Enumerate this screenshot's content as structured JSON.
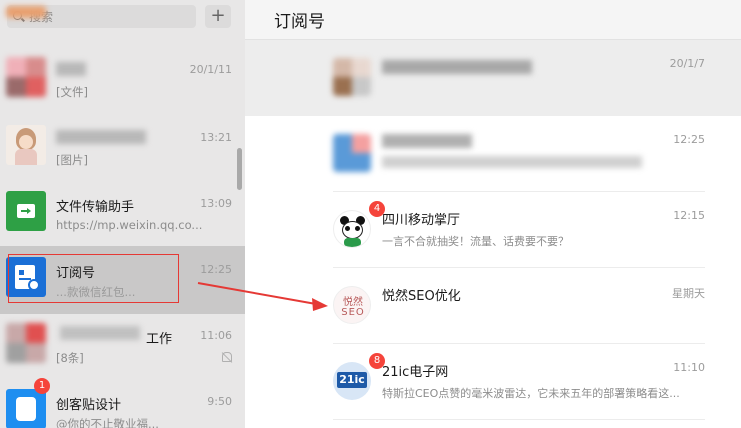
{
  "search": {
    "placeholder": "搜索",
    "add_label": "+"
  },
  "chats": [
    {
      "name": "",
      "time": "20/1/11",
      "preview": "[文件]"
    },
    {
      "name": "",
      "time": "13:21",
      "preview": "[图片]"
    },
    {
      "name": "文件传输助手",
      "time": "13:09",
      "preview": "https://mp.weixin.qq.co..."
    },
    {
      "name": "订阅号",
      "time": "12:25",
      "preview": "...款微信红包..."
    },
    {
      "name": "工作",
      "time": "11:06",
      "preview": "[8条]"
    },
    {
      "name": "创客贴设计",
      "time": "9:50",
      "preview": "@你的不止敬业福...",
      "badge": "1"
    }
  ],
  "page": {
    "title": "订阅号"
  },
  "subscriptions": [
    {
      "name": "",
      "time": "20/1/7",
      "preview": ""
    },
    {
      "name": "",
      "time": "12:25",
      "preview": ""
    },
    {
      "name": "四川移动掌厅",
      "time": "12:15",
      "preview": "一言不合就抽奖！流量、话费要不要？",
      "badge": "4"
    },
    {
      "name": "悦然SEO优化",
      "time": "星期天",
      "preview": "",
      "avatar_text_top": "悦然",
      "avatar_text_bottom": "SEO"
    },
    {
      "name": "21ic电子网",
      "time": "11:10",
      "preview": "特斯拉CEO点赞的毫米波雷达，它未来五年的部署策略看这...",
      "badge": "8",
      "avatar_text": "21ic"
    }
  ],
  "colors": {
    "accent_red": "#e53935",
    "badge_red": "#f5443b",
    "wechat_green": "#2ea045",
    "sub_blue": "#1a6fd6"
  }
}
